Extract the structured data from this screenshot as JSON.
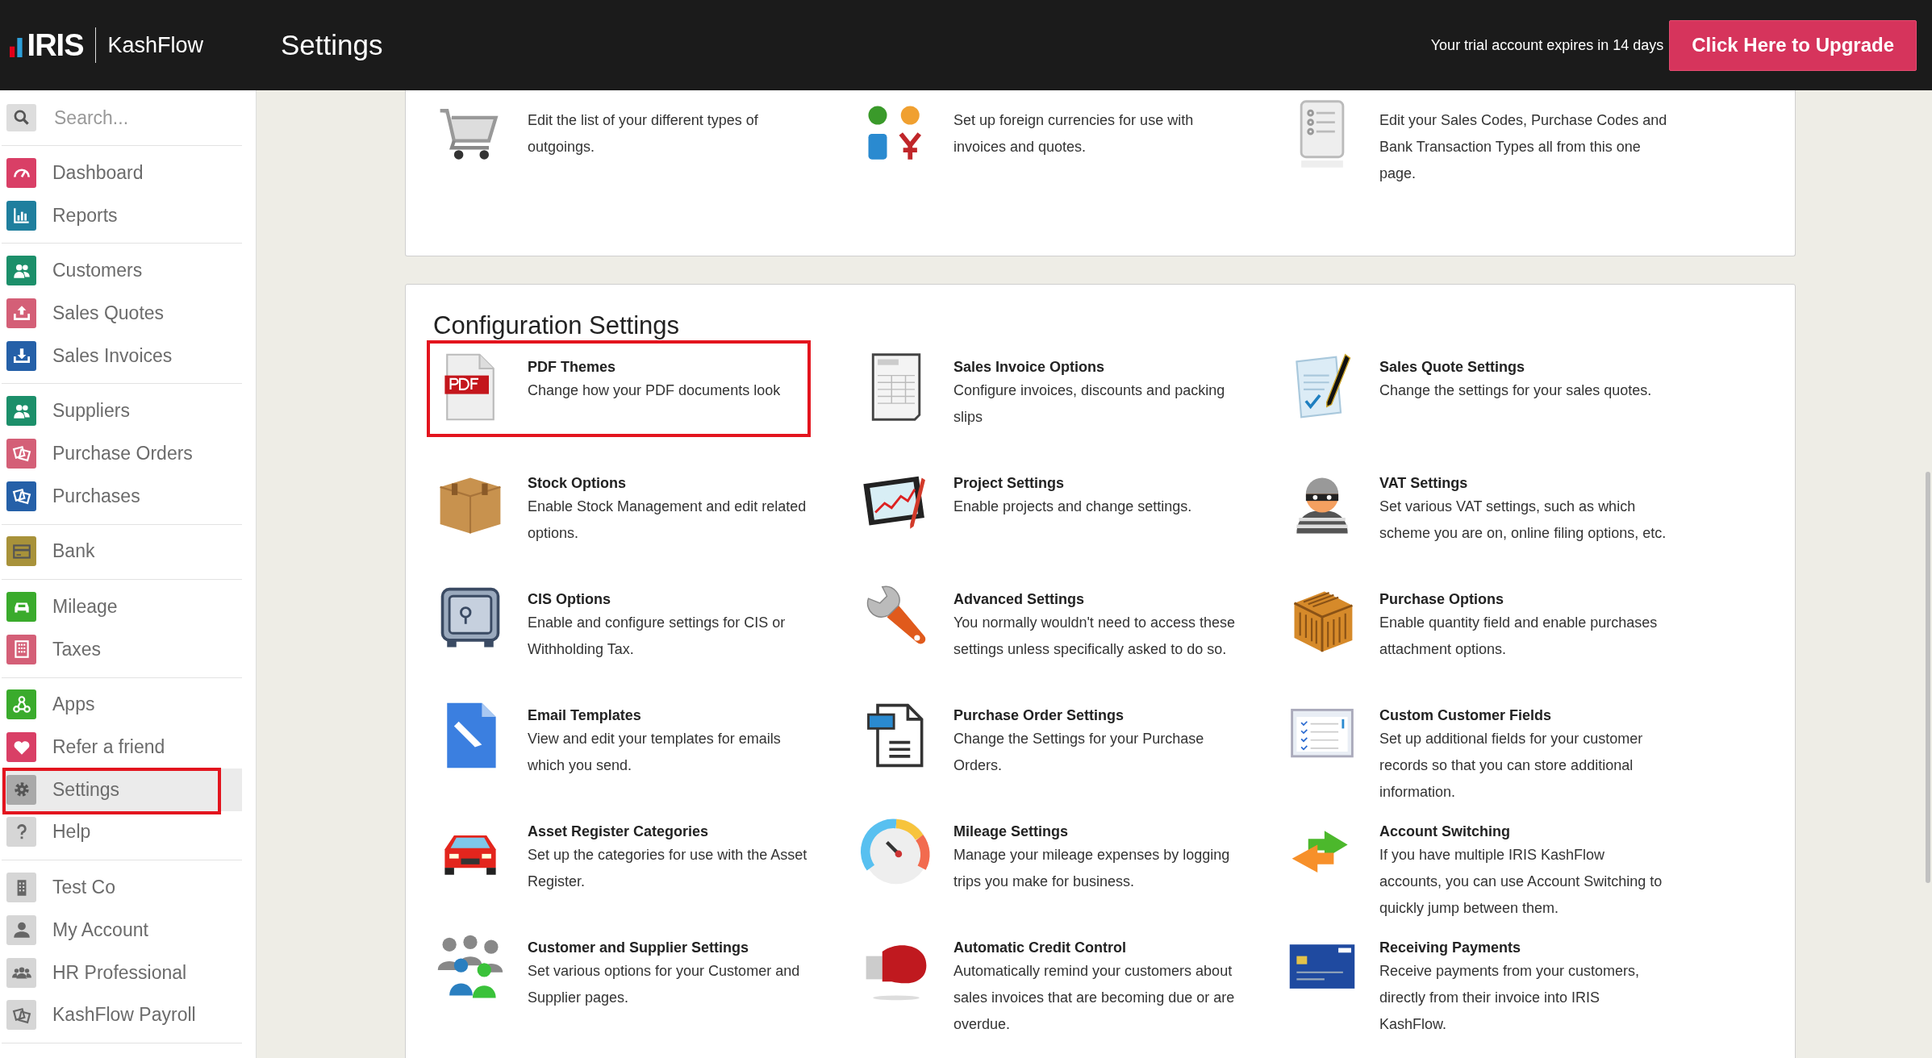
{
  "header": {
    "logo": {
      "brand": "IRIS",
      "product": "KashFlow"
    },
    "title": "Settings",
    "trial_notice": "Your trial account expires in 14 days",
    "upgrade_button": "Click Here to Upgrade"
  },
  "sidebar": {
    "search": {
      "placeholder": "Search..."
    },
    "groups": [
      {
        "items": [
          {
            "label": "Dashboard",
            "color": "#d93f66",
            "selected": false,
            "highlighted": false
          },
          {
            "label": "Reports",
            "color": "#1f7f9e",
            "selected": false,
            "highlighted": false
          }
        ]
      },
      {
        "items": [
          {
            "label": "Customers",
            "color": "#1c8f6a",
            "selected": false,
            "highlighted": false
          },
          {
            "label": "Sales Quotes",
            "color": "#d45f77",
            "selected": false,
            "highlighted": false
          },
          {
            "label": "Sales Invoices",
            "color": "#2560a8",
            "selected": false,
            "highlighted": false
          }
        ]
      },
      {
        "items": [
          {
            "label": "Suppliers",
            "color": "#1c8f6a",
            "selected": false,
            "highlighted": false
          },
          {
            "label": "Purchase Orders",
            "color": "#d45f77",
            "selected": false,
            "highlighted": false
          },
          {
            "label": "Purchases",
            "color": "#2560a8",
            "selected": false,
            "highlighted": false
          }
        ]
      },
      {
        "items": [
          {
            "label": "Bank",
            "color": "#a8923a",
            "selected": false,
            "highlighted": false
          }
        ]
      },
      {
        "items": [
          {
            "label": "Mileage",
            "color": "#3aab2c",
            "selected": false,
            "highlighted": false
          },
          {
            "label": "Taxes",
            "color": "#d45f77",
            "selected": false,
            "highlighted": false
          }
        ]
      },
      {
        "items": [
          {
            "label": "Apps",
            "color": "#3aab2c",
            "selected": false,
            "highlighted": false
          },
          {
            "label": "Refer a friend",
            "color": "#d93f66",
            "selected": false,
            "highlighted": false
          },
          {
            "label": "Settings",
            "color": "#a9a9a9",
            "selected": true,
            "highlighted": true
          },
          {
            "label": "Help",
            "color": "#d6d6d6",
            "selected": false,
            "highlighted": false
          }
        ]
      },
      {
        "items": [
          {
            "label": "Test Co",
            "color": "#d6d6d6",
            "selected": false,
            "highlighted": false
          },
          {
            "label": "My Account",
            "color": "#d6d6d6",
            "selected": false,
            "highlighted": false
          },
          {
            "label": "HR Professional",
            "color": "#d6d6d6",
            "selected": false,
            "highlighted": false
          },
          {
            "label": "KashFlow Payroll",
            "color": "#d6d6d6",
            "selected": false,
            "highlighted": false
          }
        ]
      }
    ]
  },
  "sections": [
    {
      "items": [
        {
          "description": "Edit the list of your different types of outgoings.",
          "highlighted": false
        },
        {
          "description": "Set up foreign currencies for use with invoices and quotes.",
          "highlighted": false
        },
        {
          "description": "Edit your Sales Codes, Purchase Codes and Bank Transaction Types all from this one page.",
          "highlighted": false
        }
      ]
    },
    {
      "heading": "Configuration Settings",
      "items": [
        {
          "title": "PDF Themes",
          "description": "Change how your PDF documents look",
          "highlighted": true
        },
        {
          "title": "Sales Invoice Options",
          "description": "Configure invoices, discounts and packing slips",
          "highlighted": false
        },
        {
          "title": "Sales Quote Settings",
          "description": "Change the settings for your sales quotes.",
          "highlighted": false
        },
        {
          "title": "Stock Options",
          "description": "Enable Stock Management and edit related options.",
          "highlighted": false
        },
        {
          "title": "Project Settings",
          "description": "Enable projects and change settings.",
          "highlighted": false
        },
        {
          "title": "VAT Settings",
          "description": "Set various VAT settings, such as which scheme you are on, online filing options, etc.",
          "highlighted": false
        },
        {
          "title": "CIS Options",
          "description": "Enable and configure settings for CIS or Withholding Tax.",
          "highlighted": false
        },
        {
          "title": "Advanced Settings",
          "description": "You normally wouldn't need to access these settings unless specifically asked to do so.",
          "highlighted": false
        },
        {
          "title": "Purchase Options",
          "description": "Enable quantity field and enable purchases attachment options.",
          "highlighted": false
        },
        {
          "title": "Email Templates",
          "description": "View and edit your templates for emails which you send.",
          "highlighted": false
        },
        {
          "title": "Purchase Order Settings",
          "description": "Change the Settings for your Purchase Orders.",
          "highlighted": false
        },
        {
          "title": "Custom Customer Fields",
          "description": "Set up additional fields for your customer records so that you can store additional information.",
          "highlighted": false
        },
        {
          "title": "Asset Register Categories",
          "description": "Set up the categories for use with the Asset Register.",
          "highlighted": false
        },
        {
          "title": "Mileage Settings",
          "description": "Manage your mileage expenses by logging trips you make for business.",
          "highlighted": false
        },
        {
          "title": "Account Switching",
          "description": "If you have multiple IRIS KashFlow accounts, you can use Account Switching to quickly jump between them.",
          "highlighted": false
        },
        {
          "title": "Customer and Supplier Settings",
          "description": "Set various options for your Customer and Supplier pages.",
          "highlighted": false
        },
        {
          "title": "Automatic Credit Control",
          "description": "Automatically remind your customers about sales invoices that are becoming due or are overdue.",
          "highlighted": false
        },
        {
          "title": "Receiving Payments",
          "description": "Receive payments from your customers, directly from their invoice into IRIS KashFlow.",
          "highlighted": false
        }
      ]
    }
  ]
}
